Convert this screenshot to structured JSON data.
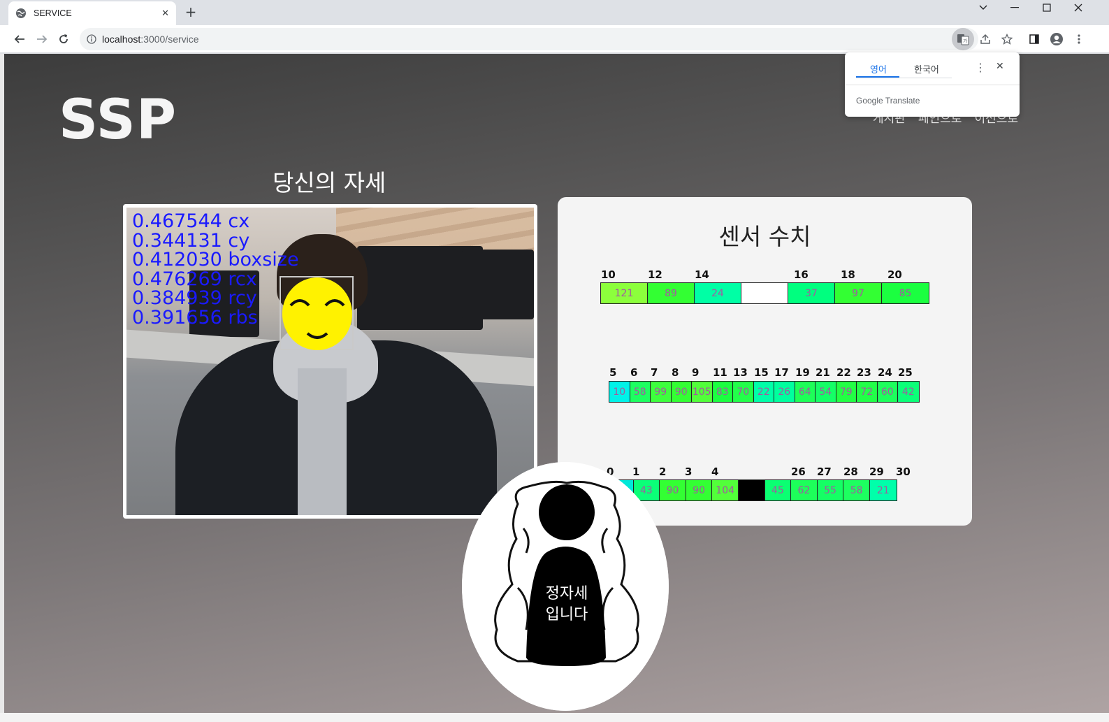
{
  "browser": {
    "tab_title": "SERVICE",
    "tab_close": "✕",
    "new_tab": "+",
    "url_host": "localhost",
    "url_rest": ":3000/service",
    "window_controls": [
      "⌄",
      "—",
      "☐",
      "✕"
    ]
  },
  "translate_popup": {
    "tab_english": "영어",
    "tab_korean": "한국어",
    "brand": "Google Translate",
    "menu_icon": "⋮",
    "close_icon": "✕"
  },
  "page": {
    "logo": "SSP",
    "nav": [
      "게시판",
      "페인으로",
      "이전으로"
    ],
    "posture_heading": "당신의 자세",
    "camera_overlay": [
      "0.467544 cx",
      "0.344131 cy",
      "0.412030 boxsize",
      "0.476269 rcx",
      "0.384939 rcy",
      "0.391656 rbs"
    ],
    "sensor_title": "센서 수치",
    "posture_figure_text_1": "정자세",
    "posture_figure_text_2": "입니다"
  },
  "sensor_rows": [
    {
      "labels": [
        "10",
        "12",
        "14",
        "16",
        "18",
        "20"
      ],
      "cells": [
        {
          "value": "121",
          "color": "#8cff3c"
        },
        {
          "value": "89",
          "color": "#33ff33"
        },
        {
          "value": "24",
          "color": "#00ffa5"
        },
        {
          "value": "",
          "color": "#ffffff"
        },
        {
          "value": "37",
          "color": "#00ff7f"
        },
        {
          "value": "97",
          "color": "#33ff33"
        },
        {
          "value": "85",
          "color": "#1bff40"
        }
      ]
    },
    {
      "labels": [
        "5",
        "6",
        "7",
        "8",
        "9",
        "11",
        "13",
        "15",
        "17",
        "19",
        "21",
        "22",
        "23",
        "24",
        "25"
      ],
      "cells": [
        {
          "value": "10",
          "color": "#00f2e8"
        },
        {
          "value": "58",
          "color": "#1dff60"
        },
        {
          "value": "99",
          "color": "#3dff3d"
        },
        {
          "value": "90",
          "color": "#33ff33"
        },
        {
          "value": "105",
          "color": "#52ff3a"
        },
        {
          "value": "83",
          "color": "#1bff40"
        },
        {
          "value": "70",
          "color": "#22ff4a"
        },
        {
          "value": "22",
          "color": "#00ffa8"
        },
        {
          "value": "26",
          "color": "#00ff9e"
        },
        {
          "value": "64",
          "color": "#1dff58"
        },
        {
          "value": "54",
          "color": "#14ff66"
        },
        {
          "value": "79",
          "color": "#22ff44"
        },
        {
          "value": "72",
          "color": "#22ff48"
        },
        {
          "value": "60",
          "color": "#1dff5c"
        },
        {
          "value": "42",
          "color": "#0bff78"
        }
      ]
    },
    {
      "labels": [
        "0",
        "1",
        "2",
        "3",
        "4",
        "26",
        "27",
        "28",
        "29",
        "30"
      ],
      "cells": [
        {
          "value": "",
          "color": "#00e8d8"
        },
        {
          "value": "43",
          "color": "#0bff78"
        },
        {
          "value": "90",
          "color": "#33ff33"
        },
        {
          "value": "90",
          "color": "#33ff33"
        },
        {
          "value": "104",
          "color": "#52ff3a"
        },
        {
          "value": "",
          "color": "#000000"
        },
        {
          "value": "45",
          "color": "#0bff72"
        },
        {
          "value": "62",
          "color": "#1dff5a"
        },
        {
          "value": "55",
          "color": "#14ff64"
        },
        {
          "value": "58",
          "color": "#1dff60"
        },
        {
          "value": "21",
          "color": "#00ffaa"
        }
      ]
    }
  ]
}
